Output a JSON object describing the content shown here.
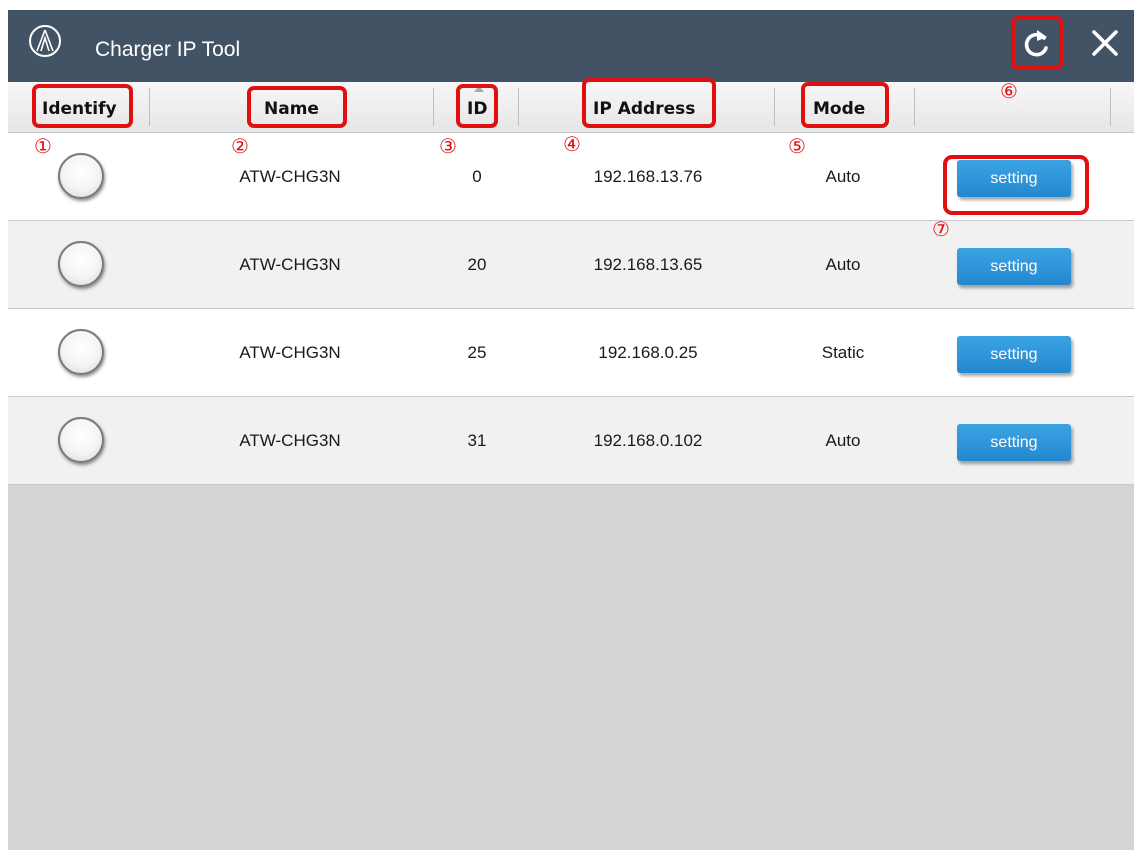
{
  "window": {
    "title": "Charger IP Tool"
  },
  "icons": {
    "logo": "audio-technica-logo-icon",
    "refresh": "refresh-icon",
    "close": "close-icon"
  },
  "columns": {
    "identify": "Identify",
    "name": "Name",
    "id": "ID",
    "ip": "IP Address",
    "mode": "Mode"
  },
  "rows": [
    {
      "name": "ATW-CHG3N",
      "id": "0",
      "ip": "192.168.13.76",
      "mode": "Auto",
      "setting_label": "setting"
    },
    {
      "name": "ATW-CHG3N",
      "id": "20",
      "ip": "192.168.13.65",
      "mode": "Auto",
      "setting_label": "setting"
    },
    {
      "name": "ATW-CHG3N",
      "id": "25",
      "ip": "192.168.0.25",
      "mode": "Static",
      "setting_label": "setting"
    },
    {
      "name": "ATW-CHG3N",
      "id": "31",
      "ip": "192.168.0.102",
      "mode": "Auto",
      "setting_label": "setting"
    }
  ],
  "callouts": {
    "identify": "①",
    "name": "②",
    "id": "③",
    "ip": "④",
    "mode": "⑤",
    "refresh": "⑥",
    "setting": "⑦"
  },
  "colors": {
    "titlebar": "#435366",
    "highlight": "#e01010",
    "button": "#2b8fd6",
    "empty_area": "#d4d4d4"
  }
}
